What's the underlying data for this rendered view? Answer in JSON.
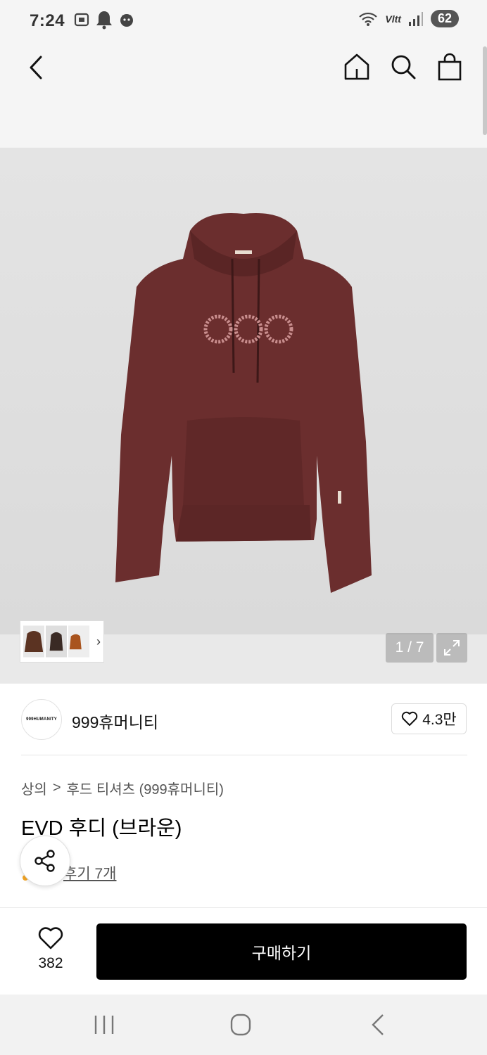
{
  "status_bar": {
    "time": "7:24",
    "network": "Vltt",
    "battery": "62"
  },
  "product_images": {
    "counter": "1 / 7"
  },
  "brand": {
    "logo_text": "999HUMANITY",
    "name": "999휴머니티",
    "like_count": "4.3만"
  },
  "breadcrumb": {
    "category": "상의",
    "separator": ">",
    "subcategory": "후드 티셔츠 (999휴머니티)"
  },
  "product": {
    "title": "EVD 후디 (브라운)",
    "review_link": "후기 7개"
  },
  "action_bar": {
    "wish_count": "382",
    "buy_label": "구매하기"
  },
  "colors": {
    "hoodie": "#6b2e2e",
    "buy_button": "#000000"
  }
}
